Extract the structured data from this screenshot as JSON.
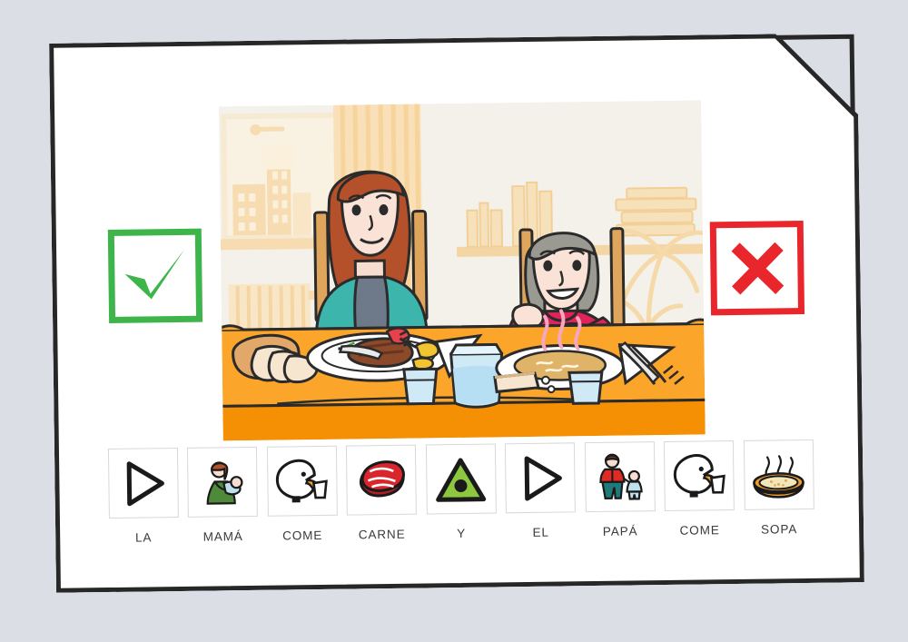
{
  "page": {
    "background_color": "#dcdee5",
    "sheet_color": "#ffffff",
    "sheet_border_color": "#272727",
    "folded_corner": "top-right"
  },
  "verdicts": [
    {
      "name": "correct",
      "icon": "check-icon",
      "label": "",
      "color": "#3db54a",
      "position": "left"
    },
    {
      "name": "incorrect",
      "icon": "cross-icon",
      "label": "",
      "color": "#e8262c",
      "position": "right"
    }
  ],
  "scene": {
    "name": "family-meal-illustration",
    "description": "Mother eating meat and father eating soup at a dining table",
    "background_color": "#f4f1ea",
    "table_top_color": "#fba62b",
    "table_front_color": "#f59004",
    "mother": {
      "hair_color": "#b4512a",
      "cardigan_color": "#3cb5ad",
      "shirt_color": "#6e7a8a",
      "action": "cutting meat with knife and fork"
    },
    "father": {
      "hair_color": "#9a9a93",
      "sweater_color": "#e0245a",
      "action": "holding a spoon of soup"
    },
    "items": [
      "bread loaf",
      "plate of meat",
      "napkin",
      "glass of water",
      "water pitcher",
      "soup bowl",
      "bread slice",
      "knife and fork"
    ]
  },
  "sentence": {
    "text": "LA MAMÁ COME CARNE Y EL PAPÁ COME SOPA",
    "words": [
      {
        "label": "LA",
        "pictogram": "article-triangle-icon"
      },
      {
        "label": "MAMÁ",
        "pictogram": "mother-with-baby-icon"
      },
      {
        "label": "COME",
        "pictogram": "eating-mouth-icon"
      },
      {
        "label": "CARNE",
        "pictogram": "meat-steak-icon"
      },
      {
        "label": "Y",
        "pictogram": "conjunction-triangle-icon"
      },
      {
        "label": "EL",
        "pictogram": "article-triangle-icon"
      },
      {
        "label": "PAPÁ",
        "pictogram": "father-with-child-icon"
      },
      {
        "label": "COME",
        "pictogram": "eating-mouth-icon"
      },
      {
        "label": "SOPA",
        "pictogram": "soup-bowl-icon"
      }
    ]
  }
}
